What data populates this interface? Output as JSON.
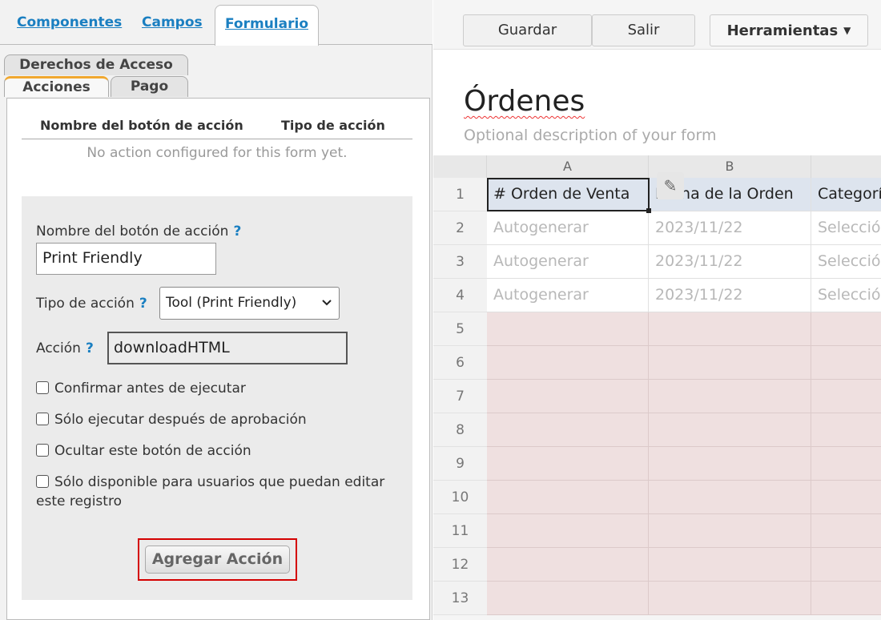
{
  "top_tabs": {
    "componentes": "Componentes",
    "campos": "Campos",
    "formulario": "Formulario"
  },
  "sub_tabs": {
    "derechos": "Derechos de Acceso",
    "acciones": "Acciones",
    "pago": "Pago"
  },
  "table": {
    "col_name": "Nombre del botón de acción",
    "col_type": "Tipo de acción",
    "empty": "No action configured for this form yet."
  },
  "form": {
    "name_label": "Nombre del botón de acción",
    "help": "?",
    "name_value": "Print Friendly",
    "type_label": "Tipo de acción",
    "type_value": "Tool (Print Friendly)",
    "action_label": "Acción",
    "action_value": "downloadHTML",
    "checkboxes": [
      "Confirmar antes de ejecutar",
      "Sólo ejecutar después de aprobación",
      "Ocultar este botón de acción",
      "Sólo disponible para usuarios que puedan editar este registro"
    ],
    "add_button": "Agregar Acción"
  },
  "toolbar": {
    "save": "Guardar",
    "exit": "Salir",
    "tools": "Herramientas"
  },
  "form_title": "Órdenes",
  "form_description": "Optional description of your form",
  "grid": {
    "columns": [
      "A",
      "B"
    ],
    "header_row": [
      "# Orden de Venta",
      "Fecha de la Orden",
      "Categoría"
    ],
    "data_row": [
      "Autogenerar",
      "2023/11/22",
      "Selección"
    ],
    "row_numbers": [
      "1",
      "2",
      "3",
      "4",
      "5",
      "6",
      "7",
      "8",
      "9",
      "10",
      "11",
      "12",
      "13"
    ]
  },
  "icons": {
    "pencil": "pencil-icon",
    "dropdown": "chevron-down-icon",
    "caret": "caret-down-icon"
  },
  "colors": {
    "link": "#1a7fc1",
    "tab_accent": "#f0a830",
    "highlight": "#d40000",
    "header_row": "#dde4ee",
    "empty_row": "#efe0e0"
  }
}
